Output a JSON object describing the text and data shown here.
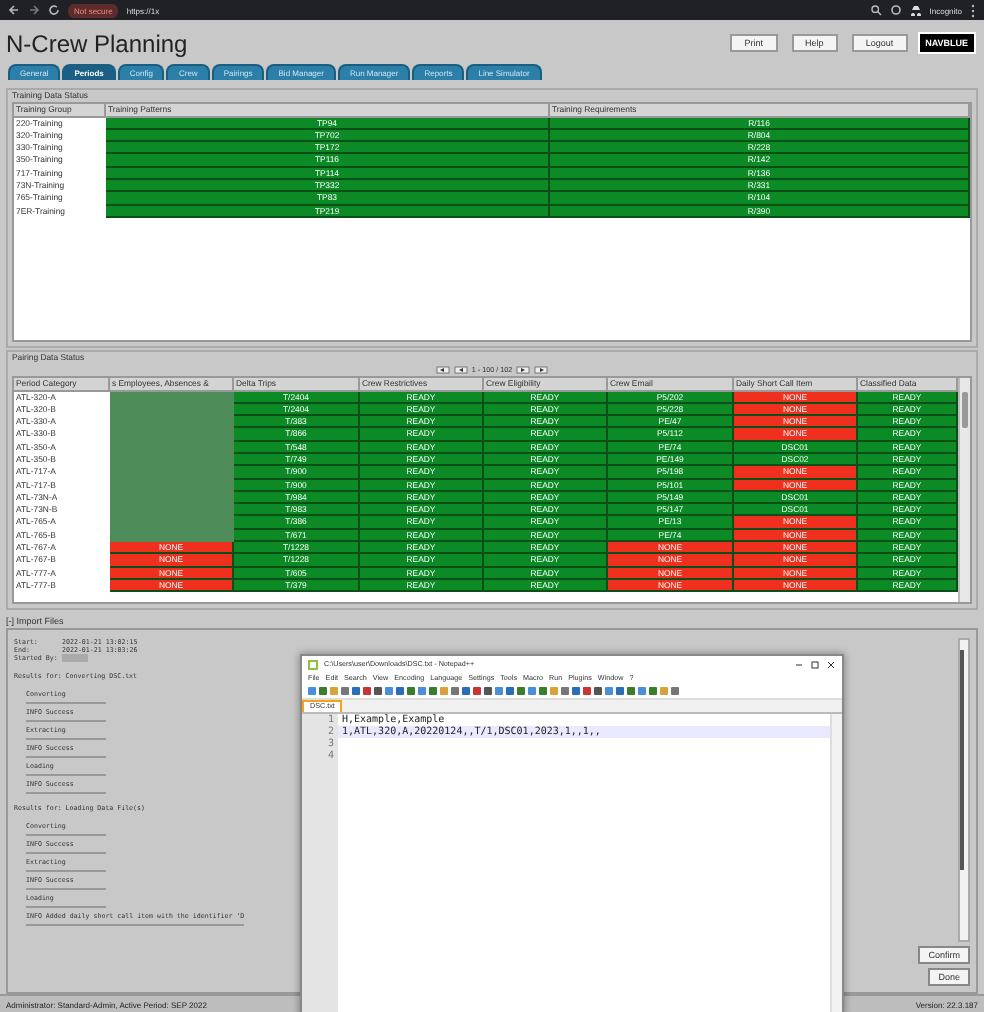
{
  "browser": {
    "security": "Not secure",
    "url": "https://1x",
    "profile": "Incognito"
  },
  "header": {
    "title": "N-Crew Planning",
    "buttons": [
      "Print",
      "Help",
      "Logout"
    ],
    "logo": "NAVBLUE"
  },
  "tabs": [
    {
      "label": "General",
      "selected": false
    },
    {
      "label": "Periods",
      "selected": true
    },
    {
      "label": "Config",
      "selected": false
    },
    {
      "label": "Crew",
      "selected": false
    },
    {
      "label": "Pairings",
      "selected": false
    },
    {
      "label": "Bid Manager",
      "selected": false
    },
    {
      "label": "Run Manager",
      "selected": false
    },
    {
      "label": "Reports",
      "selected": false
    },
    {
      "label": "Line Simulator",
      "selected": false
    }
  ],
  "training": {
    "title": "Training Data Status",
    "columns": [
      "Training Group",
      "Training Patterns",
      "Training Requirements"
    ],
    "rows": [
      {
        "group": "220-Training",
        "pattern": "TP94",
        "requirement": "R/116"
      },
      {
        "group": "320-Training",
        "pattern": "TP702",
        "requirement": "R/804"
      },
      {
        "group": "330-Training",
        "pattern": "TP172",
        "requirement": "R/228"
      },
      {
        "group": "350-Training",
        "pattern": "TP116",
        "requirement": "R/142"
      },
      {
        "group": "717-Training",
        "pattern": "TP114",
        "requirement": "R/136"
      },
      {
        "group": "73N-Training",
        "pattern": "TP332",
        "requirement": "R/331"
      },
      {
        "group": "765-Training",
        "pattern": "TP83",
        "requirement": "R/104"
      },
      {
        "group": "7ER-Training",
        "pattern": "TP219",
        "requirement": "R/390"
      }
    ]
  },
  "pairing": {
    "title": "Pairing Data Status",
    "pager": "1 - 100 / 102",
    "columns": [
      "Period Category",
      "s Employees, Absences &",
      "Delta Trips",
      "Crew Restrictives",
      "Crew Eligibility",
      "Crew Email",
      "Daily Short Call Item",
      "Classified Data"
    ],
    "rows": [
      {
        "cells": [
          {
            "text": "ATL-320-A"
          },
          {
            "color": "#4e8c5a"
          },
          {
            "text": "T/2404",
            "color": "#0b8a25"
          },
          {
            "text": "READY",
            "color": "#0b8a25"
          },
          {
            "text": "READY",
            "color": "#0b8a25"
          },
          {
            "text": "P5/202",
            "color": "#0b8a25"
          },
          {
            "text": "NONE",
            "color": "#f0301e"
          },
          {
            "text": "READY",
            "color": "#0b8a25"
          }
        ]
      },
      {
        "cells": [
          {
            "text": "ATL-320-B"
          },
          {
            "color": "#4e8c5a"
          },
          {
            "text": "T/2404",
            "color": "#0b8a25"
          },
          {
            "text": "READY",
            "color": "#0b8a25"
          },
          {
            "text": "READY",
            "color": "#0b8a25"
          },
          {
            "text": "P5/228",
            "color": "#0b8a25"
          },
          {
            "text": "NONE",
            "color": "#f0301e"
          },
          {
            "text": "READY",
            "color": "#0b8a25"
          }
        ]
      },
      {
        "cells": [
          {
            "text": "ATL-330-A"
          },
          {
            "color": "#4e8c5a"
          },
          {
            "text": "T/383",
            "color": "#0b8a25"
          },
          {
            "text": "READY",
            "color": "#0b8a25"
          },
          {
            "text": "READY",
            "color": "#0b8a25"
          },
          {
            "text": "PE/47",
            "color": "#0b8a25"
          },
          {
            "text": "NONE",
            "color": "#f0301e"
          },
          {
            "text": "READY",
            "color": "#0b8a25"
          }
        ]
      },
      {
        "cells": [
          {
            "text": "ATL-330-B"
          },
          {
            "color": "#4e8c5a"
          },
          {
            "text": "T/866",
            "color": "#0b8a25"
          },
          {
            "text": "READY",
            "color": "#0b8a25"
          },
          {
            "text": "READY",
            "color": "#0b8a25"
          },
          {
            "text": "P5/112",
            "color": "#0b8a25"
          },
          {
            "text": "NONE",
            "color": "#f0301e"
          },
          {
            "text": "READY",
            "color": "#0b8a25"
          }
        ]
      },
      {
        "cells": [
          {
            "text": "ATL-350-A"
          },
          {
            "color": "#4e8c5a"
          },
          {
            "text": "T/548",
            "color": "#0b8a25"
          },
          {
            "text": "READY",
            "color": "#0b8a25"
          },
          {
            "text": "READY",
            "color": "#0b8a25"
          },
          {
            "text": "PE/74",
            "color": "#0b8a25"
          },
          {
            "text": "DSC01",
            "color": "#0b8a25"
          },
          {
            "text": "READY",
            "color": "#0b8a25"
          }
        ]
      },
      {
        "cells": [
          {
            "text": "ATL-350-B"
          },
          {
            "color": "#4e8c5a"
          },
          {
            "text": "T/749",
            "color": "#0b8a25"
          },
          {
            "text": "READY",
            "color": "#0b8a25"
          },
          {
            "text": "READY",
            "color": "#0b8a25"
          },
          {
            "text": "PE/149",
            "color": "#0b8a25"
          },
          {
            "text": "DSC02",
            "color": "#0b8a25"
          },
          {
            "text": "READY",
            "color": "#0b8a25"
          }
        ]
      },
      {
        "cells": [
          {
            "text": "ATL-717-A"
          },
          {
            "color": "#4e8c5a"
          },
          {
            "text": "T/900",
            "color": "#0b8a25"
          },
          {
            "text": "READY",
            "color": "#0b8a25"
          },
          {
            "text": "READY",
            "color": "#0b8a25"
          },
          {
            "text": "P5/198",
            "color": "#0b8a25"
          },
          {
            "text": "NONE",
            "color": "#f0301e"
          },
          {
            "text": "READY",
            "color": "#0b8a25"
          }
        ]
      },
      {
        "cells": [
          {
            "text": "ATL-717-B"
          },
          {
            "color": "#4e8c5a"
          },
          {
            "text": "T/900",
            "color": "#0b8a25"
          },
          {
            "text": "READY",
            "color": "#0b8a25"
          },
          {
            "text": "READY",
            "color": "#0b8a25"
          },
          {
            "text": "P5/101",
            "color": "#0b8a25"
          },
          {
            "text": "NONE",
            "color": "#f0301e"
          },
          {
            "text": "READY",
            "color": "#0b8a25"
          }
        ]
      },
      {
        "cells": [
          {
            "text": "ATL-73N-A"
          },
          {
            "color": "#4e8c5a"
          },
          {
            "text": "T/984",
            "color": "#0b8a25"
          },
          {
            "text": "READY",
            "color": "#0b8a25"
          },
          {
            "text": "READY",
            "color": "#0b8a25"
          },
          {
            "text": "P5/149",
            "color": "#0b8a25"
          },
          {
            "text": "DSC01",
            "color": "#0b8a25"
          },
          {
            "text": "READY",
            "color": "#0b8a25"
          }
        ]
      },
      {
        "cells": [
          {
            "text": "ATL-73N-B"
          },
          {
            "color": "#4e8c5a"
          },
          {
            "text": "T/983",
            "color": "#0b8a25"
          },
          {
            "text": "READY",
            "color": "#0b8a25"
          },
          {
            "text": "READY",
            "color": "#0b8a25"
          },
          {
            "text": "P5/147",
            "color": "#0b8a25"
          },
          {
            "text": "DSC01",
            "color": "#0b8a25"
          },
          {
            "text": "READY",
            "color": "#0b8a25"
          }
        ]
      },
      {
        "cells": [
          {
            "text": "ATL-765-A"
          },
          {
            "color": "#4e8c5a"
          },
          {
            "text": "T/386",
            "color": "#0b8a25"
          },
          {
            "text": "READY",
            "color": "#0b8a25"
          },
          {
            "text": "READY",
            "color": "#0b8a25"
          },
          {
            "text": "PE/13",
            "color": "#0b8a25"
          },
          {
            "text": "NONE",
            "color": "#f0301e"
          },
          {
            "text": "READY",
            "color": "#0b8a25"
          }
        ]
      },
      {
        "cells": [
          {
            "text": "ATL-765-B"
          },
          {
            "color": "#4e8c5a"
          },
          {
            "text": "T/671",
            "color": "#0b8a25"
          },
          {
            "text": "READY",
            "color": "#0b8a25"
          },
          {
            "text": "READY",
            "color": "#0b8a25"
          },
          {
            "text": "PE/74",
            "color": "#0b8a25"
          },
          {
            "text": "NONE",
            "color": "#f0301e"
          },
          {
            "text": "READY",
            "color": "#0b8a25"
          }
        ]
      },
      {
        "cells": [
          {
            "text": "ATL-767-A"
          },
          {
            "text": "NONE",
            "color": "#f0301e"
          },
          {
            "text": "T/1228",
            "color": "#0b8a25"
          },
          {
            "text": "READY",
            "color": "#0b8a25"
          },
          {
            "text": "READY",
            "color": "#0b8a25"
          },
          {
            "text": "NONE",
            "color": "#f0301e"
          },
          {
            "text": "NONE",
            "color": "#f0301e"
          },
          {
            "text": "READY",
            "color": "#0b8a25"
          }
        ]
      },
      {
        "cells": [
          {
            "text": "ATL-767-B"
          },
          {
            "text": "NONE",
            "color": "#f0301e"
          },
          {
            "text": "T/1228",
            "color": "#0b8a25"
          },
          {
            "text": "READY",
            "color": "#0b8a25"
          },
          {
            "text": "READY",
            "color": "#0b8a25"
          },
          {
            "text": "NONE",
            "color": "#f0301e"
          },
          {
            "text": "NONE",
            "color": "#f0301e"
          },
          {
            "text": "READY",
            "color": "#0b8a25"
          }
        ]
      },
      {
        "cells": [
          {
            "text": "ATL-777-A"
          },
          {
            "text": "NONE",
            "color": "#f0301e"
          },
          {
            "text": "T/605",
            "color": "#0b8a25"
          },
          {
            "text": "READY",
            "color": "#0b8a25"
          },
          {
            "text": "READY",
            "color": "#0b8a25"
          },
          {
            "text": "NONE",
            "color": "#f0301e"
          },
          {
            "text": "NONE",
            "color": "#f0301e"
          },
          {
            "text": "READY",
            "color": "#0b8a25"
          }
        ]
      },
      {
        "cells": [
          {
            "text": "ATL-777-B"
          },
          {
            "text": "NONE",
            "color": "#f0301e"
          },
          {
            "text": "T/379",
            "color": "#0b8a25"
          },
          {
            "text": "READY",
            "color": "#0b8a25"
          },
          {
            "text": "READY",
            "color": "#0b8a25"
          },
          {
            "text": "NONE",
            "color": "#f0301e"
          },
          {
            "text": "NONE",
            "color": "#f0301e"
          },
          {
            "text": "READY",
            "color": "#0b8a25"
          }
        ]
      }
    ]
  },
  "import": {
    "title": "[-] Import Files",
    "log": [
      {
        "kind": "field",
        "label": "Start:",
        "value": "2022-01-21 13:02:15"
      },
      {
        "kind": "field",
        "label": "End:",
        "value": "2022-01-21 13:03:26"
      },
      {
        "kind": "field",
        "label": "Started By:",
        "redacted": true
      },
      {
        "kind": "heading",
        "text": "Results for: Converting DSC.txt"
      },
      {
        "kind": "step",
        "text": "Converting"
      },
      {
        "kind": "step",
        "text": "INFO Success"
      },
      {
        "kind": "step",
        "text": "Extracting"
      },
      {
        "kind": "step",
        "text": "INFO Success"
      },
      {
        "kind": "step",
        "text": "Loading"
      },
      {
        "kind": "step",
        "text": "INFO Success"
      },
      {
        "kind": "heading",
        "text": "Results for: Loading Data File(s)"
      },
      {
        "kind": "step",
        "text": "Converting"
      },
      {
        "kind": "step",
        "text": "INFO Success"
      },
      {
        "kind": "step",
        "text": "Extracting"
      },
      {
        "kind": "step",
        "text": "INFO Success"
      },
      {
        "kind": "step",
        "text": "Loading"
      },
      {
        "kind": "step",
        "text": "INFO Added daily short call item with the identifier 'D"
      }
    ],
    "buttons": [
      "Confirm",
      "Done"
    ]
  },
  "notepad": {
    "title": "C:\\Users\\user\\Downloads\\DSC.txt - Notepad++",
    "menu": [
      "File",
      "Edit",
      "Search",
      "View",
      "Encoding",
      "Language",
      "Settings",
      "Tools",
      "Macro",
      "Run",
      "Plugins",
      "Window",
      "?"
    ],
    "tab": "DSC.txt",
    "lines": [
      {
        "number": "1",
        "text": "H,Example,Example"
      },
      {
        "number": "2",
        "text": "1,ATL,320,A,20220124,,T/1,DSC01,2023,1,,1,,"
      },
      {
        "number": "3"
      },
      {
        "number": "4"
      }
    ]
  },
  "status_bar": {
    "user": "Administrator: Standard-Admin, Active Period: SEP 2022",
    "version": "Version: 22.3.187"
  }
}
